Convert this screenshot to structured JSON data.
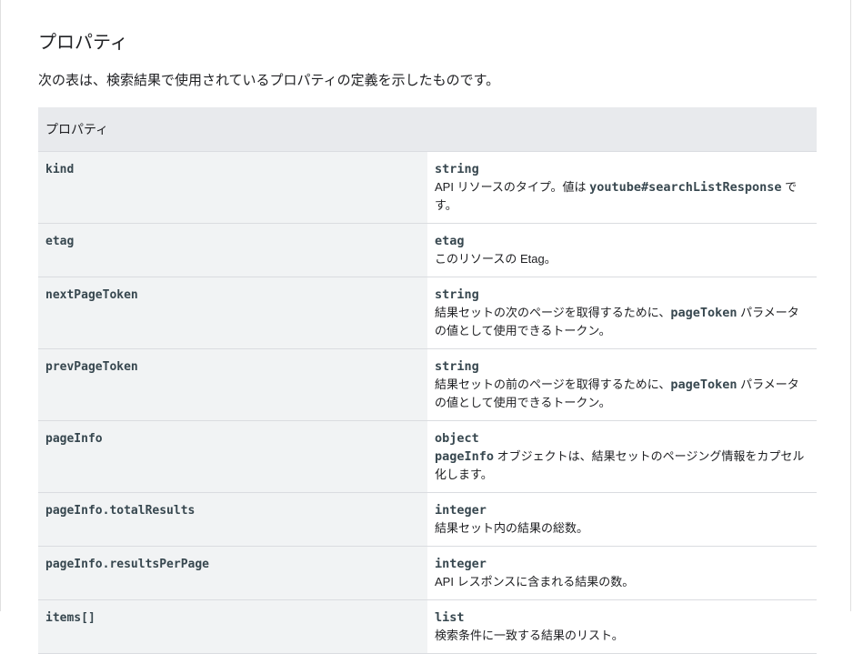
{
  "section": {
    "title": "プロパティ",
    "description": "次の表は、検索結果で使用されているプロパティの定義を示したものです。"
  },
  "table": {
    "header": "プロパティ",
    "rows": [
      {
        "name": "kind",
        "type": "string",
        "desc_parts": [
          {
            "text": "API リソースのタイプ。値は ",
            "code": false
          },
          {
            "text": "youtube#searchListResponse",
            "code": true
          },
          {
            "text": " です。",
            "code": false
          }
        ]
      },
      {
        "name": "etag",
        "type": "etag",
        "desc_parts": [
          {
            "text": "このリソースの Etag。",
            "code": false
          }
        ]
      },
      {
        "name": "nextPageToken",
        "type": "string",
        "desc_parts": [
          {
            "text": "結果セットの次のページを取得するために、",
            "code": false
          },
          {
            "text": "pageToken",
            "code": true
          },
          {
            "text": " パラメータの値として使用できるトークン。",
            "code": false
          }
        ]
      },
      {
        "name": "prevPageToken",
        "type": "string",
        "desc_parts": [
          {
            "text": "結果セットの前のページを取得するために、",
            "code": false
          },
          {
            "text": "pageToken",
            "code": true
          },
          {
            "text": " パラメータの値として使用できるトークン。",
            "code": false
          }
        ]
      },
      {
        "name": "pageInfo",
        "type": "object",
        "desc_parts": [
          {
            "text": "pageInfo",
            "code": true
          },
          {
            "text": " オブジェクトは、結果セットのページング情報をカプセル化します。",
            "code": false
          }
        ]
      },
      {
        "name": "pageInfo.totalResults",
        "type": "integer",
        "desc_parts": [
          {
            "text": "結果セット内の結果の総数。",
            "code": false
          }
        ]
      },
      {
        "name": "pageInfo.resultsPerPage",
        "type": "integer",
        "desc_parts": [
          {
            "text": "API レスポンスに含まれる結果の数。",
            "code": false
          }
        ]
      },
      {
        "name": "items[]",
        "type": "list",
        "desc_parts": [
          {
            "text": "検索条件に一致する結果のリスト。",
            "code": false
          }
        ]
      }
    ]
  }
}
